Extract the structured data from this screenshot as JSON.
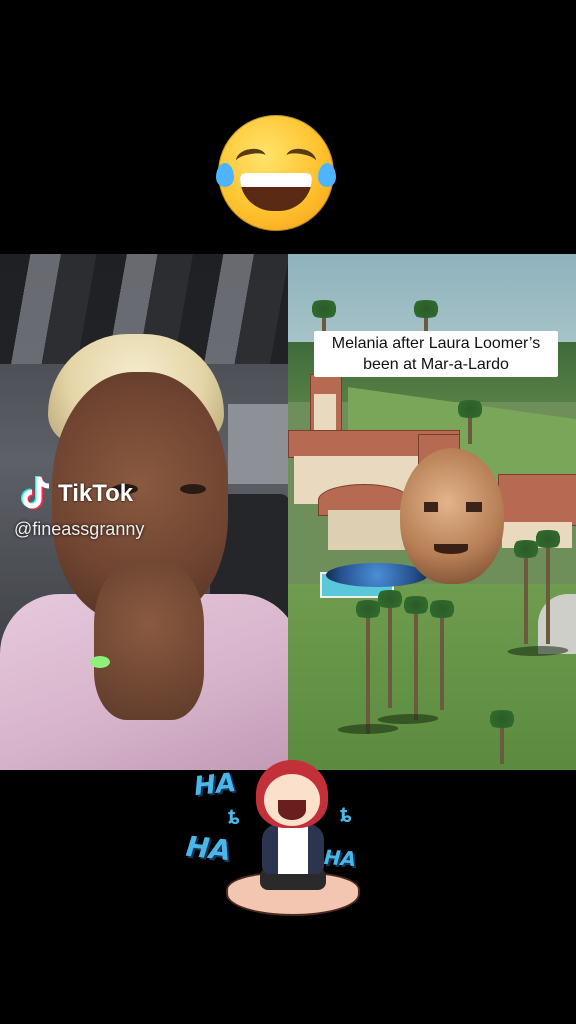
{
  "top_emoji": {
    "icon": "face-with-tears-of-joy-icon"
  },
  "left_video": {
    "watermark_brand": "TikTok",
    "watermark_handle": "@fineassgranny",
    "brand_icon": "tiktok-note-icon"
  },
  "right_video": {
    "caption_line1": "Melania after Laura Loomer’s",
    "caption_line2": "been at Mar-a-Lardo"
  },
  "bottom_sticker": {
    "text_1": "HA",
    "text_2": "HA",
    "text_3": "HA",
    "icon": "laughing-chibi-sticker"
  },
  "colors": {
    "background": "#000000",
    "sticker_text": "#4db6e8",
    "tiktok_cyan": "#25f4ee",
    "tiktok_red": "#fe2c55"
  }
}
